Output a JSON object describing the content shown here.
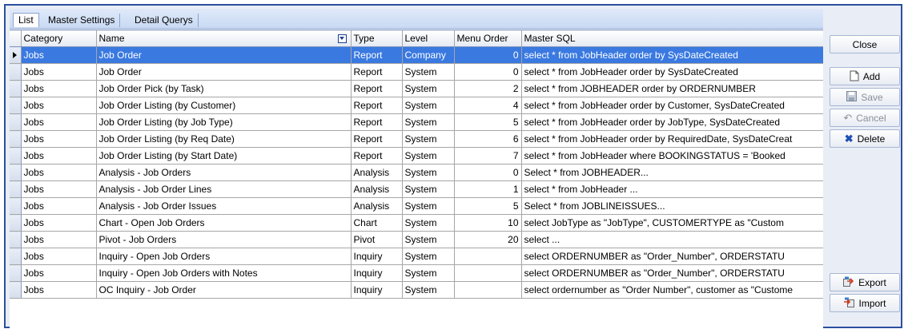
{
  "tabs": [
    {
      "label": "List",
      "active": true
    },
    {
      "label": "Master Settings",
      "active": false
    },
    {
      "label": "Detail Querys",
      "active": false
    }
  ],
  "grid": {
    "columns": [
      "Category",
      "Name",
      "Type",
      "Level",
      "Menu Order",
      "Master SQL"
    ],
    "rows": [
      {
        "category": "Jobs",
        "name": "Job Order",
        "type": "Report",
        "level": "Company",
        "menu_order": "0",
        "sql": "select * from JobHeader order by SysDateCreated"
      },
      {
        "category": "Jobs",
        "name": "Job Order",
        "type": "Report",
        "level": "System",
        "menu_order": "0",
        "sql": "select * from JobHeader order by SysDateCreated"
      },
      {
        "category": "Jobs",
        "name": "Job Order Pick (by Task)",
        "type": "Report",
        "level": "System",
        "menu_order": "2",
        "sql": "select * from JOBHEADER order by ORDERNUMBER"
      },
      {
        "category": "Jobs",
        "name": "Job Order Listing (by Customer)",
        "type": "Report",
        "level": "System",
        "menu_order": "4",
        "sql": "select * from JobHeader order by Customer, SysDateCreated"
      },
      {
        "category": "Jobs",
        "name": "Job Order Listing (by Job Type)",
        "type": "Report",
        "level": "System",
        "menu_order": "5",
        "sql": "select * from JobHeader order by JobType, SysDateCreated"
      },
      {
        "category": "Jobs",
        "name": "Job Order Listing (by Req Date)",
        "type": "Report",
        "level": "System",
        "menu_order": "6",
        "sql": "select * from JobHeader order by RequiredDate, SysDateCreat"
      },
      {
        "category": "Jobs",
        "name": "Job Order Listing (by Start Date)",
        "type": "Report",
        "level": "System",
        "menu_order": "7",
        "sql": "select * from JobHeader where BOOKINGSTATUS = 'Booked"
      },
      {
        "category": "Jobs",
        "name": "Analysis - Job Orders",
        "type": "Analysis",
        "level": "System",
        "menu_order": "0",
        "sql": "Select * from JOBHEADER..."
      },
      {
        "category": "Jobs",
        "name": "Analysis - Job Order Lines",
        "type": "Analysis",
        "level": "System",
        "menu_order": "1",
        "sql": "select * from JobHeader ..."
      },
      {
        "category": "Jobs",
        "name": "Analysis - Job Order Issues",
        "type": "Analysis",
        "level": "System",
        "menu_order": "5",
        "sql": "Select * from JOBLINEISSUES..."
      },
      {
        "category": "Jobs",
        "name": "Chart - Open Job Orders",
        "type": "Chart",
        "level": "System",
        "menu_order": "10",
        "sql": "select  JobType as \"JobType\", CUSTOMERTYPE as \"Custom"
      },
      {
        "category": "Jobs",
        "name": "Pivot - Job Orders",
        "type": "Pivot",
        "level": "System",
        "menu_order": "20",
        "sql": "select ..."
      },
      {
        "category": "Jobs",
        "name": "Inquiry - Open Job Orders",
        "type": "Inquiry",
        "level": "System",
        "menu_order": "",
        "sql": "select ORDERNUMBER as \"Order_Number\", ORDERSTATU"
      },
      {
        "category": "Jobs",
        "name": "Inquiry - Open Job Orders with Notes",
        "type": "Inquiry",
        "level": "System",
        "menu_order": "",
        "sql": "select ORDERNUMBER as \"Order_Number\", ORDERSTATU"
      },
      {
        "category": "Jobs",
        "name": "OC Inquiry - Job Order",
        "type": "Inquiry",
        "level": "System",
        "menu_order": "",
        "sql": "select ordernumber as \"Order Number\", customer as \"Custome"
      }
    ],
    "selected_row": 0
  },
  "buttons": {
    "close": "Close",
    "add": "Add",
    "save": "Save",
    "cancel": "Cancel",
    "delete": "Delete",
    "export": "Export",
    "import": "Import"
  },
  "icons": {
    "name_filter": "filter-icon",
    "add": "new-document-icon",
    "save": "floppy-disk-icon",
    "cancel": "undo-icon",
    "delete": "red-x-icon",
    "export": "export-icon",
    "import": "import-icon"
  },
  "colors": {
    "selection": "#3a79e0",
    "frame": "#2b4f9e"
  }
}
